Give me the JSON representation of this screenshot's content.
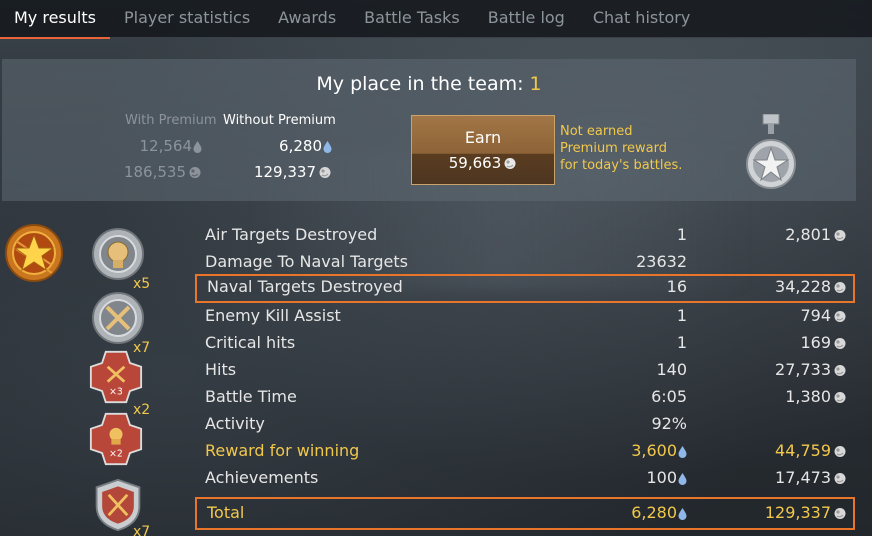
{
  "tabs": [
    {
      "label": "My results",
      "active": true
    },
    {
      "label": "Player statistics",
      "active": false
    },
    {
      "label": "Awards",
      "active": false
    },
    {
      "label": "Battle Tasks",
      "active": false
    },
    {
      "label": "Battle log",
      "active": false
    },
    {
      "label": "Chat history",
      "active": false
    }
  ],
  "summary": {
    "place_label": "My place in the team:",
    "place_value": "1",
    "with_premium_label": "With Premium",
    "without_premium_label": "Without Premium",
    "with_premium_rp": "12,564",
    "with_premium_sl": "186,535",
    "without_premium_rp": "6,280",
    "without_premium_sl": "129,337",
    "earn_label": "Earn",
    "earn_value": "59,663",
    "not_earned_text_1": "Not earned",
    "not_earned_text_2": "Premium reward",
    "not_earned_text_3": "for today's battles."
  },
  "awards": [
    {
      "name": "eagle-medal",
      "multiplier": "x5"
    },
    {
      "name": "crossed-swords-medal",
      "multiplier": "x7"
    },
    {
      "name": "triple-kill-cross",
      "multiplier": "x2",
      "badge": "×3"
    },
    {
      "name": "double-kill-cross",
      "multiplier": "",
      "badge": "×2"
    },
    {
      "name": "shield-crossed-swords",
      "multiplier": "x7"
    }
  ],
  "results": [
    {
      "label": "Air Targets Destroyed",
      "count": "1",
      "reward": "2,801",
      "count_icon": "",
      "reward_icon": "silver-lion"
    },
    {
      "label": "Damage To Naval Targets",
      "count": "23632",
      "reward": "",
      "count_icon": "",
      "reward_icon": ""
    },
    {
      "label": "Naval Targets Destroyed",
      "count": "16",
      "reward": "34,228",
      "count_icon": "",
      "reward_icon": "silver-lion"
    },
    {
      "label": "Enemy Kill Assist",
      "count": "1",
      "reward": "794",
      "count_icon": "",
      "reward_icon": "silver-lion"
    },
    {
      "label": "Critical hits",
      "count": "1",
      "reward": "169",
      "count_icon": "",
      "reward_icon": "silver-lion"
    },
    {
      "label": "Hits",
      "count": "140",
      "reward": "27,733",
      "count_icon": "",
      "reward_icon": "silver-lion"
    },
    {
      "label": "Battle Time",
      "count": "6:05",
      "reward": "1,380",
      "count_icon": "",
      "reward_icon": "silver-lion"
    },
    {
      "label": "Activity",
      "count": "92%",
      "reward": "",
      "count_icon": "",
      "reward_icon": ""
    },
    {
      "label": "Reward for winning",
      "count": "3,600",
      "reward": "44,759",
      "count_icon": "research-drop",
      "reward_icon": "silver-lion"
    },
    {
      "label": "Achievements",
      "count": "100",
      "reward": "17,473",
      "count_icon": "research-drop",
      "reward_icon": "silver-lion"
    }
  ],
  "total": {
    "label": "Total",
    "count": "6,280",
    "reward": "129,337"
  },
  "colors": {
    "accent": "#e8752a",
    "gold": "#f2c84b",
    "research": "#8fb8e8"
  }
}
